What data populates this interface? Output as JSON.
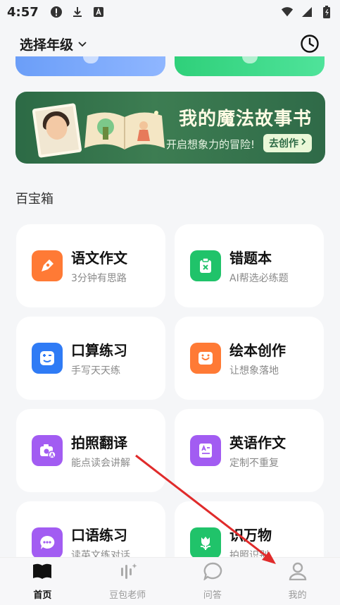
{
  "status_bar": {
    "time": "4:57"
  },
  "header": {
    "grade_label": "选择年级"
  },
  "banner": {
    "title": "我的魔法故事书",
    "subtitle": "开启想象力的冒险!",
    "cta": "去创作"
  },
  "section": {
    "title": "百宝箱"
  },
  "tools": [
    {
      "title": "语文作文",
      "subtitle": "3分钟有思路",
      "color": "#ff7a35"
    },
    {
      "title": "错题本",
      "subtitle": "AI帮选必练题",
      "color": "#20c36a"
    },
    {
      "title": "口算练习",
      "subtitle": "手写天天练",
      "color": "#2f7bf5"
    },
    {
      "title": "绘本创作",
      "subtitle": "让想象落地",
      "color": "#ff7a35"
    },
    {
      "title": "拍照翻译",
      "subtitle": "能点读会讲解",
      "color": "#a25cf2"
    },
    {
      "title": "英语作文",
      "subtitle": "定制不重复",
      "color": "#a25cf2"
    },
    {
      "title": "口语练习",
      "subtitle": "读英文练对话",
      "color": "#a25cf2"
    },
    {
      "title": "识万物",
      "subtitle": "拍照识别",
      "color": "#20c36a"
    }
  ],
  "nav": [
    {
      "label": "首页"
    },
    {
      "label": "豆包老师"
    },
    {
      "label": "问答"
    },
    {
      "label": "我的"
    }
  ],
  "annotation": {
    "arrow_color": "#e02b2b"
  }
}
